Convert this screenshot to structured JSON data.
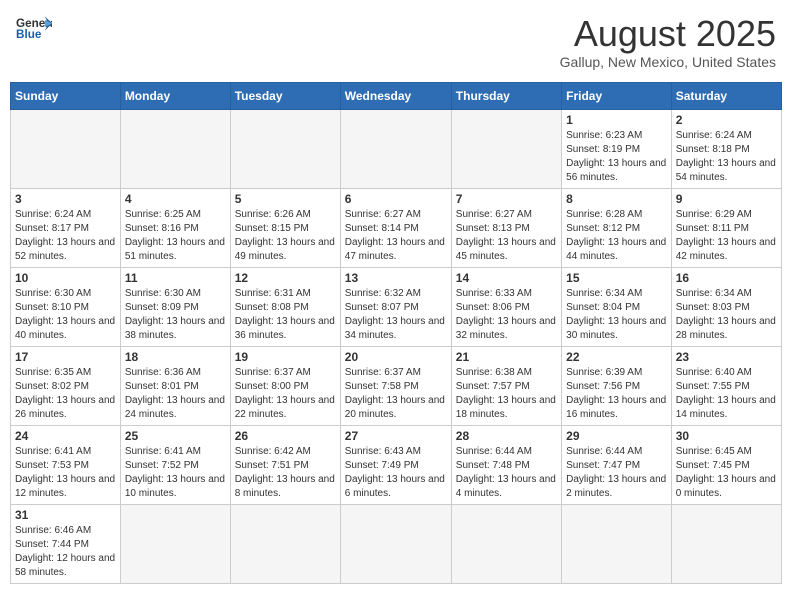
{
  "header": {
    "logo_general": "General",
    "logo_blue": "Blue",
    "title": "August 2025",
    "subtitle": "Gallup, New Mexico, United States"
  },
  "days_of_week": [
    "Sunday",
    "Monday",
    "Tuesday",
    "Wednesday",
    "Thursday",
    "Friday",
    "Saturday"
  ],
  "weeks": [
    [
      {
        "day": "",
        "info": ""
      },
      {
        "day": "",
        "info": ""
      },
      {
        "day": "",
        "info": ""
      },
      {
        "day": "",
        "info": ""
      },
      {
        "day": "",
        "info": ""
      },
      {
        "day": "1",
        "info": "Sunrise: 6:23 AM\nSunset: 8:19 PM\nDaylight: 13 hours and 56 minutes."
      },
      {
        "day": "2",
        "info": "Sunrise: 6:24 AM\nSunset: 8:18 PM\nDaylight: 13 hours and 54 minutes."
      }
    ],
    [
      {
        "day": "3",
        "info": "Sunrise: 6:24 AM\nSunset: 8:17 PM\nDaylight: 13 hours and 52 minutes."
      },
      {
        "day": "4",
        "info": "Sunrise: 6:25 AM\nSunset: 8:16 PM\nDaylight: 13 hours and 51 minutes."
      },
      {
        "day": "5",
        "info": "Sunrise: 6:26 AM\nSunset: 8:15 PM\nDaylight: 13 hours and 49 minutes."
      },
      {
        "day": "6",
        "info": "Sunrise: 6:27 AM\nSunset: 8:14 PM\nDaylight: 13 hours and 47 minutes."
      },
      {
        "day": "7",
        "info": "Sunrise: 6:27 AM\nSunset: 8:13 PM\nDaylight: 13 hours and 45 minutes."
      },
      {
        "day": "8",
        "info": "Sunrise: 6:28 AM\nSunset: 8:12 PM\nDaylight: 13 hours and 44 minutes."
      },
      {
        "day": "9",
        "info": "Sunrise: 6:29 AM\nSunset: 8:11 PM\nDaylight: 13 hours and 42 minutes."
      }
    ],
    [
      {
        "day": "10",
        "info": "Sunrise: 6:30 AM\nSunset: 8:10 PM\nDaylight: 13 hours and 40 minutes."
      },
      {
        "day": "11",
        "info": "Sunrise: 6:30 AM\nSunset: 8:09 PM\nDaylight: 13 hours and 38 minutes."
      },
      {
        "day": "12",
        "info": "Sunrise: 6:31 AM\nSunset: 8:08 PM\nDaylight: 13 hours and 36 minutes."
      },
      {
        "day": "13",
        "info": "Sunrise: 6:32 AM\nSunset: 8:07 PM\nDaylight: 13 hours and 34 minutes."
      },
      {
        "day": "14",
        "info": "Sunrise: 6:33 AM\nSunset: 8:06 PM\nDaylight: 13 hours and 32 minutes."
      },
      {
        "day": "15",
        "info": "Sunrise: 6:34 AM\nSunset: 8:04 PM\nDaylight: 13 hours and 30 minutes."
      },
      {
        "day": "16",
        "info": "Sunrise: 6:34 AM\nSunset: 8:03 PM\nDaylight: 13 hours and 28 minutes."
      }
    ],
    [
      {
        "day": "17",
        "info": "Sunrise: 6:35 AM\nSunset: 8:02 PM\nDaylight: 13 hours and 26 minutes."
      },
      {
        "day": "18",
        "info": "Sunrise: 6:36 AM\nSunset: 8:01 PM\nDaylight: 13 hours and 24 minutes."
      },
      {
        "day": "19",
        "info": "Sunrise: 6:37 AM\nSunset: 8:00 PM\nDaylight: 13 hours and 22 minutes."
      },
      {
        "day": "20",
        "info": "Sunrise: 6:37 AM\nSunset: 7:58 PM\nDaylight: 13 hours and 20 minutes."
      },
      {
        "day": "21",
        "info": "Sunrise: 6:38 AM\nSunset: 7:57 PM\nDaylight: 13 hours and 18 minutes."
      },
      {
        "day": "22",
        "info": "Sunrise: 6:39 AM\nSunset: 7:56 PM\nDaylight: 13 hours and 16 minutes."
      },
      {
        "day": "23",
        "info": "Sunrise: 6:40 AM\nSunset: 7:55 PM\nDaylight: 13 hours and 14 minutes."
      }
    ],
    [
      {
        "day": "24",
        "info": "Sunrise: 6:41 AM\nSunset: 7:53 PM\nDaylight: 13 hours and 12 minutes."
      },
      {
        "day": "25",
        "info": "Sunrise: 6:41 AM\nSunset: 7:52 PM\nDaylight: 13 hours and 10 minutes."
      },
      {
        "day": "26",
        "info": "Sunrise: 6:42 AM\nSunset: 7:51 PM\nDaylight: 13 hours and 8 minutes."
      },
      {
        "day": "27",
        "info": "Sunrise: 6:43 AM\nSunset: 7:49 PM\nDaylight: 13 hours and 6 minutes."
      },
      {
        "day": "28",
        "info": "Sunrise: 6:44 AM\nSunset: 7:48 PM\nDaylight: 13 hours and 4 minutes."
      },
      {
        "day": "29",
        "info": "Sunrise: 6:44 AM\nSunset: 7:47 PM\nDaylight: 13 hours and 2 minutes."
      },
      {
        "day": "30",
        "info": "Sunrise: 6:45 AM\nSunset: 7:45 PM\nDaylight: 13 hours and 0 minutes."
      }
    ],
    [
      {
        "day": "31",
        "info": "Sunrise: 6:46 AM\nSunset: 7:44 PM\nDaylight: 12 hours and 58 minutes."
      },
      {
        "day": "",
        "info": ""
      },
      {
        "day": "",
        "info": ""
      },
      {
        "day": "",
        "info": ""
      },
      {
        "day": "",
        "info": ""
      },
      {
        "day": "",
        "info": ""
      },
      {
        "day": "",
        "info": ""
      }
    ]
  ]
}
